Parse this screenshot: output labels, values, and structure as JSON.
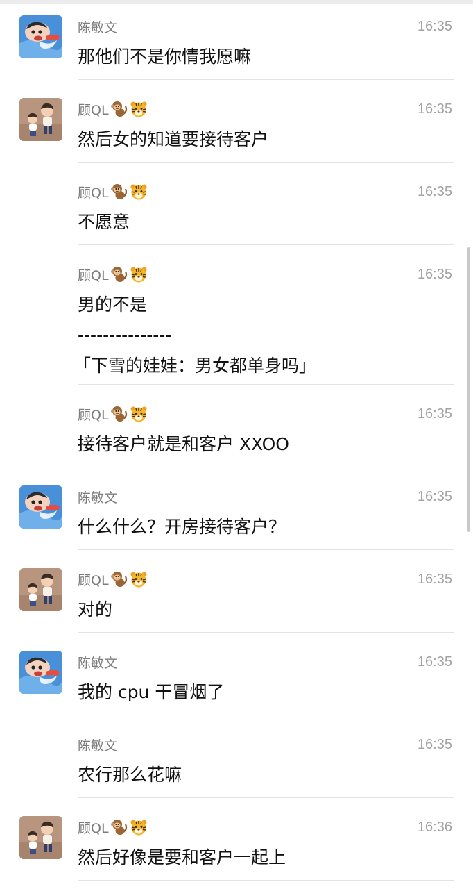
{
  "messages": [
    {
      "name": "陈敏文",
      "time": "16:35",
      "text": "那他们不是你情我愿嘛",
      "avatar": "chen",
      "emoji": false
    },
    {
      "name": "顾QL",
      "time": "16:35",
      "text": "然后女的知道要接待客户",
      "avatar": "gu",
      "emoji": true
    },
    {
      "name": "顾QL",
      "time": "16:35",
      "text": "不愿意",
      "avatar": "",
      "emoji": true
    },
    {
      "name": "顾QL",
      "time": "16:35",
      "text": "男的不是",
      "separator": "---------------",
      "quote": "「下雪的娃娃：男女都单身吗」",
      "avatar": "",
      "emoji": true
    },
    {
      "name": "顾QL",
      "time": "16:35",
      "text": "接待客户就是和客户 XXOO",
      "avatar": "",
      "emoji": true
    },
    {
      "name": "陈敏文",
      "time": "16:35",
      "text": "什么什么？开房接待客户？",
      "avatar": "chen",
      "emoji": false
    },
    {
      "name": "顾QL",
      "time": "16:35",
      "text": "对的",
      "avatar": "gu",
      "emoji": true
    },
    {
      "name": "陈敏文",
      "time": "16:35",
      "text": "我的 cpu 干冒烟了",
      "avatar": "chen",
      "emoji": false
    },
    {
      "name": "陈敏文",
      "time": "16:35",
      "text": "农行那么花嘛",
      "avatar": "",
      "emoji": false
    },
    {
      "name": "顾QL",
      "time": "16:36",
      "text": "然后好像是要和客户一起上",
      "avatar": "gu",
      "emoji": true
    }
  ],
  "icons": {
    "name_emojis": [
      "monkey-icon",
      "tiger-icon"
    ],
    "avatars": {
      "chen": "cartoon-avatar",
      "gu": "two-kids-avatar"
    }
  },
  "colors": {
    "name": "#7d7d7d",
    "time": "#a3a3a3",
    "text": "#111111",
    "divider": "#e3e3e3"
  }
}
